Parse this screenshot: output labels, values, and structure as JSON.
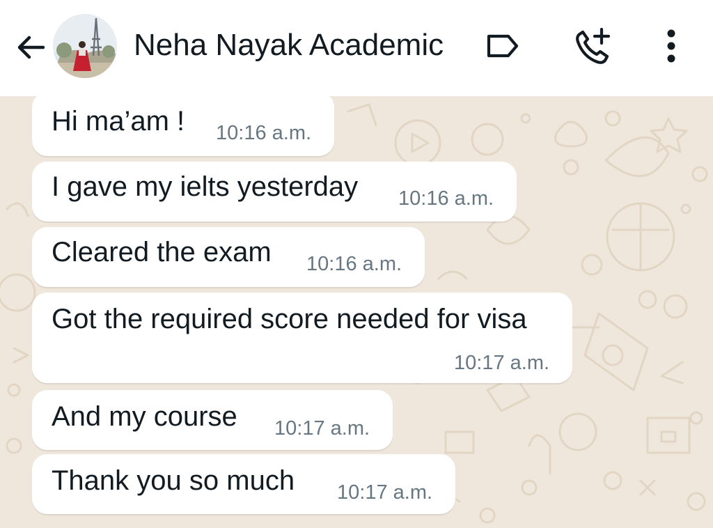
{
  "header": {
    "contact_name": "Neha Nayak Academic",
    "back_icon": "arrow-left-icon",
    "label_icon": "label-tag-icon",
    "call_icon": "add-call-icon",
    "menu_icon": "more-vertical-icon"
  },
  "messages": [
    {
      "text": "Hi ma’am !",
      "time": "10:16 a.m."
    },
    {
      "text": "I gave my ielts yesterday",
      "time": "10:16 a.m."
    },
    {
      "text": "Cleared the exam",
      "time": "10:16 a.m."
    },
    {
      "text": "Got the required score needed for visa",
      "time": "10:17 a.m."
    },
    {
      "text": "And my course",
      "time": "10:17 a.m."
    },
    {
      "text": "Thank you so much",
      "time": "10:17 a.m."
    }
  ],
  "colors": {
    "header_bg": "#ffffff",
    "chat_bg": "#efe7dc",
    "bubble_bg": "#ffffff",
    "text": "#111b21",
    "timestamp": "#667781"
  }
}
